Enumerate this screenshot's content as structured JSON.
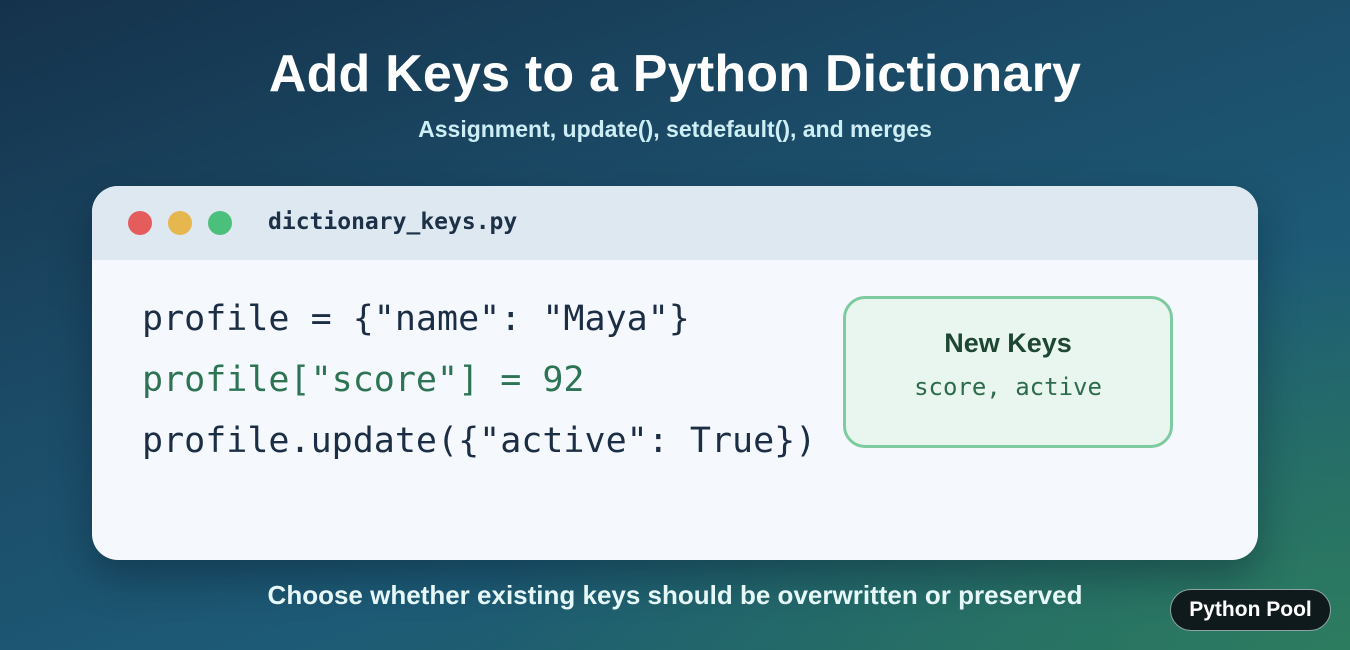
{
  "header": {
    "title": "Add Keys to a Python Dictionary",
    "subtitle": "Assignment, update(), setdefault(), and merges"
  },
  "window": {
    "filename": "dictionary_keys.py",
    "controls": [
      "close",
      "minimize",
      "maximize"
    ],
    "code_lines": [
      "profile = {\"name\": \"Maya\"}",
      "profile[\"score\"] = 92",
      "profile.update({\"active\": True})"
    ],
    "highlighted_line": 2
  },
  "keys_card": {
    "title": "New Keys",
    "keys": "score, active"
  },
  "caption": "Choose whether existing keys should be overwritten or preserved",
  "badge": "Python Pool",
  "colors": {
    "close": "#e45c5c",
    "minimize": "#e6b74f",
    "maximize": "#4bbf7c",
    "highlight": "#2c7453",
    "card_border": "#7fcaa0"
  }
}
